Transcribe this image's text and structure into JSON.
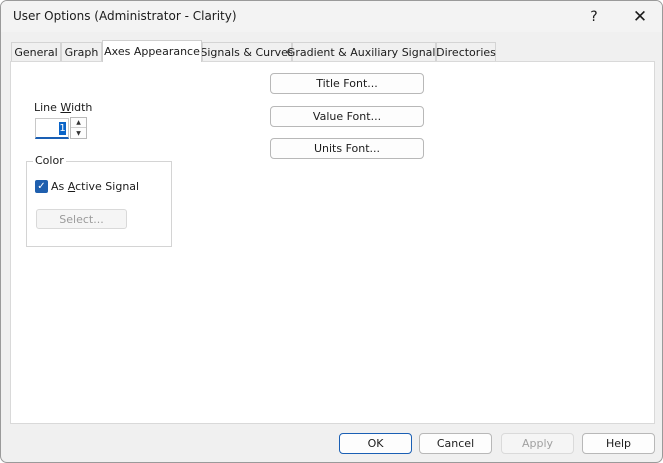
{
  "window": {
    "title": "User Options (Administrator - Clarity)",
    "help_glyph": "?",
    "close_glyph": "✕"
  },
  "tabs": [
    {
      "label": "General",
      "active": false
    },
    {
      "label": "Graph",
      "active": false
    },
    {
      "label": "Axes Appearance",
      "active": true
    },
    {
      "label": "Signals & Curves",
      "active": false
    },
    {
      "label": "Gradient & Auxiliary Signals",
      "active": false
    },
    {
      "label": "Directories",
      "active": false
    }
  ],
  "axes_appearance": {
    "line_width": {
      "label_pre": "Line ",
      "label_accel": "W",
      "label_post": "idth",
      "value": "1"
    },
    "color_group": {
      "legend": "Color",
      "as_active_signal": {
        "label_pre": "As ",
        "label_accel": "A",
        "label_post": "ctive Signal",
        "checked": true,
        "check_glyph": "✓"
      },
      "select_label": "Select..."
    },
    "font_buttons": {
      "title": "Title Font...",
      "value": "Value Font...",
      "units": "Units Font..."
    }
  },
  "buttons": {
    "ok": "OK",
    "cancel": "Cancel",
    "apply": "Apply",
    "help": "Help"
  },
  "colors": {
    "accent": "#1a5fb4",
    "checkbox": "#1f5fae",
    "disabled_text": "#a0a0a0"
  }
}
